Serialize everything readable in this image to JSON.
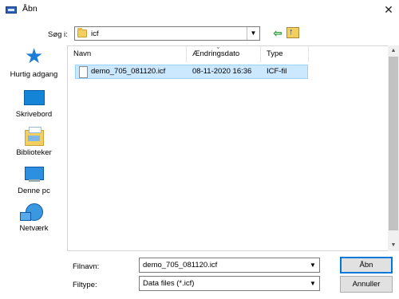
{
  "window": {
    "title": "Åbn",
    "close_glyph": "✕"
  },
  "toolbar": {
    "lookin_label": "Søg i:",
    "lookin_value": "icf",
    "back_icon": "back-arrow-icon",
    "up_icon": "up-folder-icon"
  },
  "places": [
    {
      "label": "Hurtig adgang",
      "icon": "star-icon"
    },
    {
      "label": "Skrivebord",
      "icon": "desktop-icon"
    },
    {
      "label": "Biblioteker",
      "icon": "libraries-icon"
    },
    {
      "label": "Denne pc",
      "icon": "computer-icon"
    },
    {
      "label": "Netværk",
      "icon": "network-icon"
    }
  ],
  "file_list": {
    "columns": [
      "Navn",
      "Ændringsdato",
      "Type"
    ],
    "rows": [
      {
        "name": "demo_705_081120.icf",
        "modified": "08-11-2020 16:36",
        "type": "ICF-fil",
        "selected": true
      }
    ]
  },
  "bottom": {
    "filename_label": "Filnavn:",
    "filename_value": "demo_705_081120.icf",
    "filetype_label": "Filtype:",
    "filetype_value": "Data files (*.icf)",
    "open_label": "Åbn",
    "cancel_label": "Annuller"
  },
  "colors": {
    "selection_bg": "#cce8ff",
    "selection_border": "#99d1ff",
    "accent": "#0078d7"
  }
}
